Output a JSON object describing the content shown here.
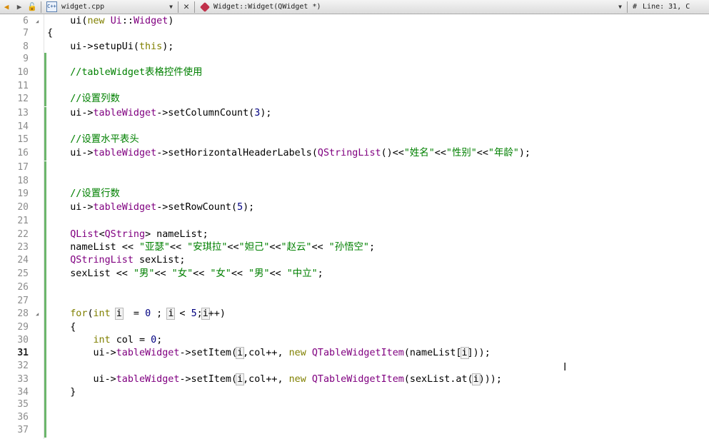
{
  "toolbar": {
    "file_name": "widget.cpp",
    "file_icon_text": "C++",
    "function_name": "Widget::Widget(QWidget *)",
    "hash": "#",
    "line_col": "Line: 31, C"
  },
  "editor": {
    "current_line": 31,
    "lines": [
      {
        "n": "6",
        "segs": [
          {
            "t": "    ui("
          },
          {
            "t": "new",
            "c": "kw"
          },
          {
            "t": " "
          },
          {
            "t": "Ui",
            "c": "cls"
          },
          {
            "t": "::"
          },
          {
            "t": "Widget",
            "c": "cls"
          },
          {
            "t": ")"
          }
        ]
      },
      {
        "n": "7",
        "segs": [
          {
            "t": "{"
          }
        ]
      },
      {
        "n": "8",
        "segs": [
          {
            "t": "    ui->setupUi("
          },
          {
            "t": "this",
            "c": "kw"
          },
          {
            "t": ");"
          }
        ]
      },
      {
        "n": "9",
        "segs": []
      },
      {
        "n": "10",
        "segs": [
          {
            "t": "    //tableWidget表格控件使用",
            "c": "cmt"
          }
        ]
      },
      {
        "n": "11",
        "segs": []
      },
      {
        "n": "12",
        "segs": [
          {
            "t": "    //设置列数",
            "c": "cmt"
          }
        ]
      },
      {
        "n": "13",
        "segs": [
          {
            "t": "    ui->"
          },
          {
            "t": "tableWidget",
            "c": "typ"
          },
          {
            "t": "->setColumnCount("
          },
          {
            "t": "3",
            "c": "num"
          },
          {
            "t": ");"
          }
        ]
      },
      {
        "n": "14",
        "segs": []
      },
      {
        "n": "15",
        "segs": [
          {
            "t": "    //设置水平表头",
            "c": "cmt"
          }
        ]
      },
      {
        "n": "16",
        "segs": [
          {
            "t": "    ui->"
          },
          {
            "t": "tableWidget",
            "c": "typ"
          },
          {
            "t": "->setHorizontalHeaderLabels("
          },
          {
            "t": "QStringList",
            "c": "cls"
          },
          {
            "t": "()<<"
          },
          {
            "t": "\"姓名\"",
            "c": "str"
          },
          {
            "t": "<<"
          },
          {
            "t": "\"性别\"",
            "c": "str"
          },
          {
            "t": "<<"
          },
          {
            "t": "\"年龄\"",
            "c": "str"
          },
          {
            "t": ");"
          }
        ]
      },
      {
        "n": "17",
        "segs": []
      },
      {
        "n": "18",
        "segs": []
      },
      {
        "n": "19",
        "segs": [
          {
            "t": "    //设置行数",
            "c": "cmt"
          }
        ]
      },
      {
        "n": "20",
        "segs": [
          {
            "t": "    ui->"
          },
          {
            "t": "tableWidget",
            "c": "typ"
          },
          {
            "t": "->setRowCount("
          },
          {
            "t": "5",
            "c": "num"
          },
          {
            "t": ");"
          }
        ]
      },
      {
        "n": "21",
        "segs": []
      },
      {
        "n": "22",
        "segs": [
          {
            "t": "    "
          },
          {
            "t": "QList",
            "c": "cls"
          },
          {
            "t": "<"
          },
          {
            "t": "QString",
            "c": "cls"
          },
          {
            "t": "> nameList;"
          }
        ]
      },
      {
        "n": "23",
        "segs": [
          {
            "t": "    nameList << "
          },
          {
            "t": "\"亚瑟\"",
            "c": "str"
          },
          {
            "t": "<< "
          },
          {
            "t": "\"安琪拉\"",
            "c": "str"
          },
          {
            "t": "<<"
          },
          {
            "t": "\"妲己\"",
            "c": "str"
          },
          {
            "t": "<<"
          },
          {
            "t": "\"赵云\"",
            "c": "str"
          },
          {
            "t": "<< "
          },
          {
            "t": "\"孙悟空\"",
            "c": "str"
          },
          {
            "t": ";"
          }
        ]
      },
      {
        "n": "24",
        "segs": [
          {
            "t": "    "
          },
          {
            "t": "QStringList",
            "c": "cls"
          },
          {
            "t": " sexList;"
          }
        ]
      },
      {
        "n": "25",
        "segs": [
          {
            "t": "    sexList << "
          },
          {
            "t": "\"男\"",
            "c": "str"
          },
          {
            "t": "<< "
          },
          {
            "t": "\"女\"",
            "c": "str"
          },
          {
            "t": "<< "
          },
          {
            "t": "\"女\"",
            "c": "str"
          },
          {
            "t": "<< "
          },
          {
            "t": "\"男\"",
            "c": "str"
          },
          {
            "t": "<< "
          },
          {
            "t": "\"中立\"",
            "c": "str"
          },
          {
            "t": ";"
          }
        ]
      },
      {
        "n": "26",
        "segs": []
      },
      {
        "n": "27",
        "segs": []
      },
      {
        "n": "28",
        "segs": [
          {
            "t": "    "
          },
          {
            "t": "for",
            "c": "kw"
          },
          {
            "t": "("
          },
          {
            "t": "int",
            "c": "kw"
          },
          {
            "t": " "
          },
          {
            "t": "i",
            "c": "var"
          },
          {
            "t": "  = "
          },
          {
            "t": "0",
            "c": "num"
          },
          {
            "t": " ; "
          },
          {
            "t": "i",
            "c": "var"
          },
          {
            "t": " < "
          },
          {
            "t": "5",
            "c": "num"
          },
          {
            "t": ";"
          },
          {
            "t": "i",
            "c": "var"
          },
          {
            "t": "++)"
          }
        ]
      },
      {
        "n": "29",
        "segs": [
          {
            "t": "    {"
          }
        ]
      },
      {
        "n": "30",
        "segs": [
          {
            "t": "        "
          },
          {
            "t": "int",
            "c": "kw"
          },
          {
            "t": " col = "
          },
          {
            "t": "0",
            "c": "num"
          },
          {
            "t": ";"
          }
        ]
      },
      {
        "n": "31",
        "segs": [
          {
            "t": "        ui->"
          },
          {
            "t": "tableWidget",
            "c": "typ"
          },
          {
            "t": "->setItem("
          },
          {
            "t": "i",
            "c": "var"
          },
          {
            "t": ",col++, "
          },
          {
            "t": "new",
            "c": "kw"
          },
          {
            "t": " "
          },
          {
            "t": "QTableWidgetItem",
            "c": "cls"
          },
          {
            "t": "(nameList["
          },
          {
            "t": "i",
            "c": "var"
          },
          {
            "t": "]));"
          }
        ]
      },
      {
        "n": "32",
        "segs": []
      },
      {
        "n": "33",
        "segs": [
          {
            "t": "        ui->"
          },
          {
            "t": "tableWidget",
            "c": "typ"
          },
          {
            "t": "->setItem("
          },
          {
            "t": "i",
            "c": "var"
          },
          {
            "t": ",col++, "
          },
          {
            "t": "new",
            "c": "kw"
          },
          {
            "t": " "
          },
          {
            "t": "QTableWidgetItem",
            "c": "cls"
          },
          {
            "t": "(sexList.at("
          },
          {
            "t": "i",
            "c": "var"
          },
          {
            "t": ")));"
          }
        ]
      },
      {
        "n": "34",
        "segs": [
          {
            "t": "    }"
          }
        ]
      },
      {
        "n": "35",
        "segs": []
      },
      {
        "n": "36",
        "segs": []
      },
      {
        "n": "37",
        "segs": []
      }
    ]
  }
}
